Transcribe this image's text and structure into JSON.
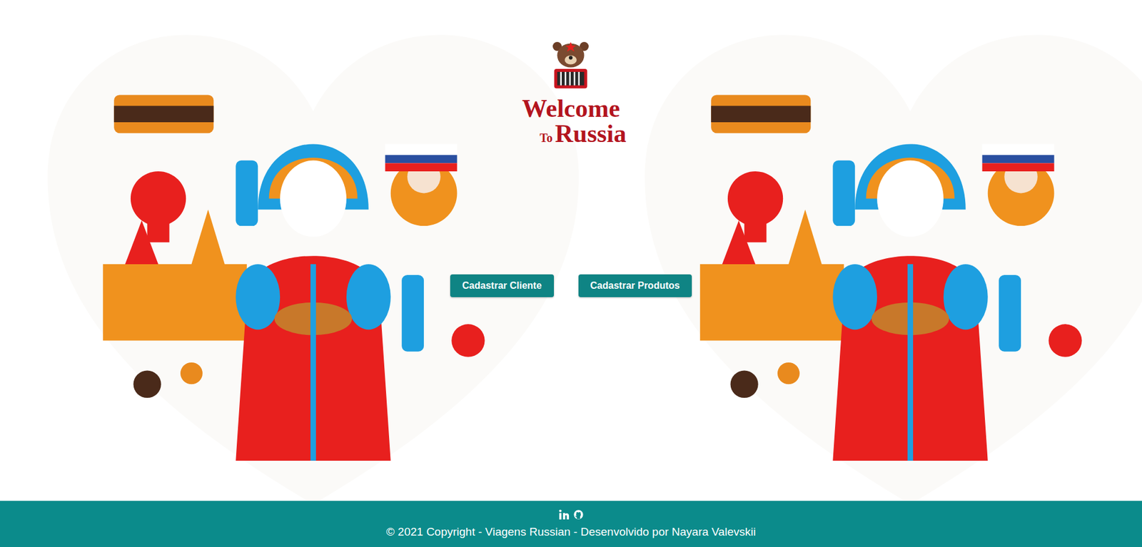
{
  "logo": {
    "line1": "Welcome",
    "small": "To",
    "line2": "Russia"
  },
  "buttons": [
    {
      "label": "Cadastrar Cliente"
    },
    {
      "label": "Cadastrar Produtos"
    }
  ],
  "footer": {
    "copyright": "© 2021 Copyright - Viagens Russian - Desenvolvido por Nayara Valevskii"
  }
}
